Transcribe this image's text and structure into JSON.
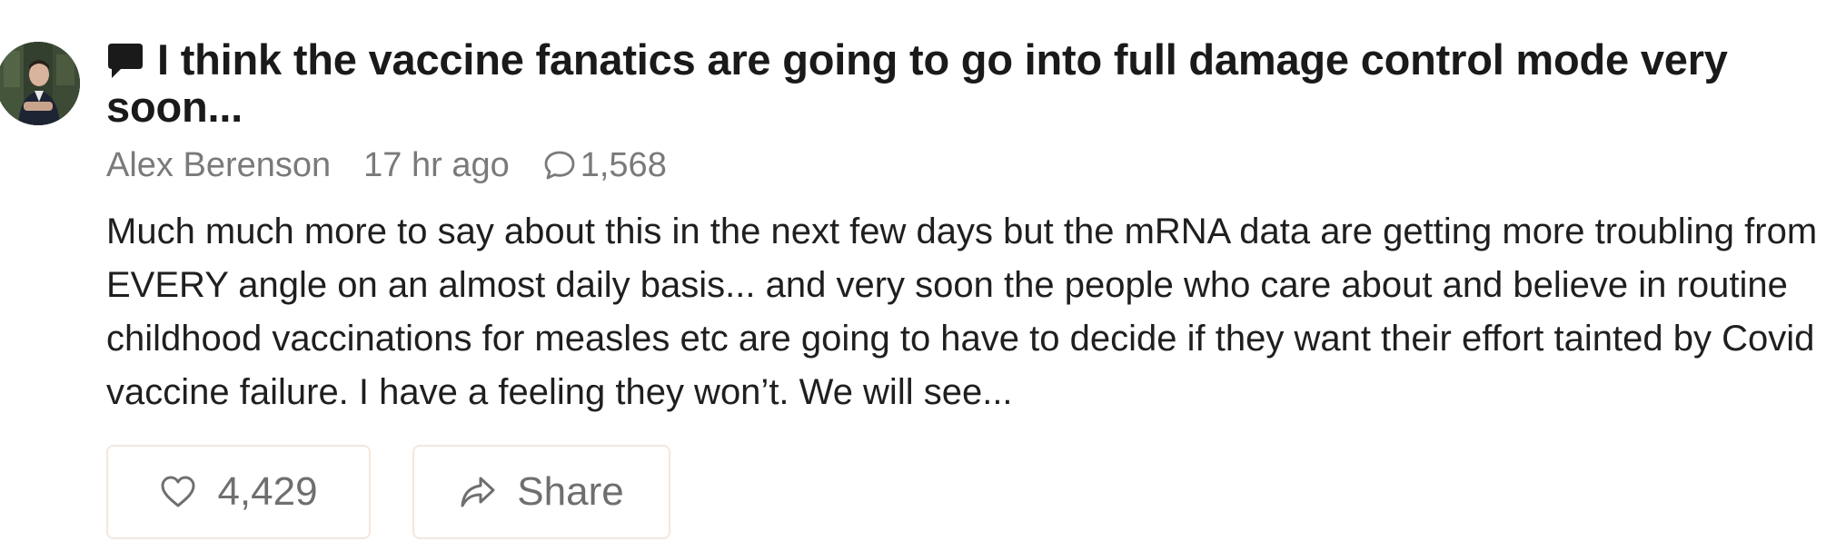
{
  "post": {
    "title": "I think the vaccine fanatics are going to go into full damage control mode very soon...",
    "author": "Alex Berenson",
    "time": "17 hr ago",
    "comment_count": "1,568",
    "body": "Much much more to say about this in the next few days but the mRNA data are getting more troubling from EVERY angle on an almost daily basis... and very soon the people who care about and believe in routine childhood vaccinations for measles etc are going to have to decide if they want their effort tainted by Covid vaccine failure. I have a feeling they won’t. We will see...",
    "title_icon": "chat-bubble-icon"
  },
  "actions": {
    "like_count": "4,429",
    "like_icon": "heart-icon",
    "share_label": "Share",
    "share_icon": "share-arrow-icon"
  },
  "colors": {
    "text": "#1f1f1f",
    "meta": "#7a7a7a",
    "button_border": "#f3e7df"
  }
}
